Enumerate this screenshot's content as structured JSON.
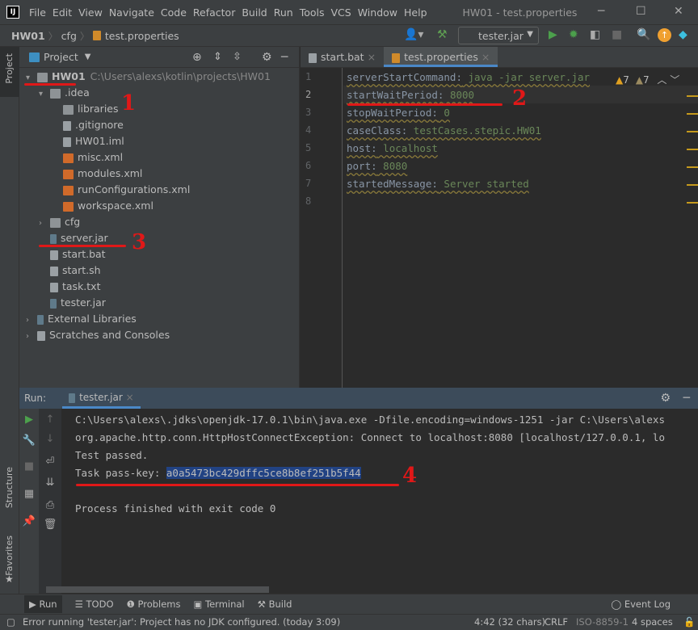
{
  "menubar": {
    "items": [
      "File",
      "Edit",
      "View",
      "Navigate",
      "Code",
      "Refactor",
      "Build",
      "Run",
      "Tools",
      "VCS",
      "Window",
      "Help"
    ],
    "window_title": "HW01 - test.properties"
  },
  "navbar": {
    "crumbs": [
      "HW01",
      "cfg",
      "test.properties"
    ],
    "run_config": "tester.jar"
  },
  "left_strip": {
    "project": "Project",
    "structure": "Structure",
    "favorites": "Favorites"
  },
  "project": {
    "title": "Project",
    "root": {
      "name": "HW01",
      "path": "C:\\Users\\alexs\\kotlin\\projects\\HW01"
    },
    "items": [
      ".idea",
      "libraries",
      ".gitignore",
      "HW01.iml",
      "misc.xml",
      "modules.xml",
      "runConfigurations.xml",
      "workspace.xml",
      "cfg",
      "server.jar",
      "start.bat",
      "start.sh",
      "task.txt",
      "tester.jar",
      "External Libraries",
      "Scratches and Consoles"
    ]
  },
  "editor": {
    "tabs": [
      "start.bat",
      "test.properties"
    ],
    "active_tab": "test.properties",
    "lines": [
      {
        "key": "serverStartCommand:",
        "value": " java -jar server.jar"
      },
      {
        "key": "startWaitPeriod:",
        "value": " 8000"
      },
      {
        "key": "stopWaitPeriod:",
        "value": " 0"
      },
      {
        "key": "caseClass:",
        "value": " testCases.stepic.HW01"
      },
      {
        "key": "host:",
        "value": " localhost"
      },
      {
        "key": "port:",
        "value": " 8080"
      },
      {
        "key": "startedMessage:",
        "value": " Server started"
      }
    ],
    "line_numbers": [
      "1",
      "2",
      "3",
      "4",
      "5",
      "6",
      "7",
      "8"
    ],
    "warnings": "7",
    "weak_warnings": "7"
  },
  "run": {
    "label": "Run:",
    "tab": "tester.jar",
    "output": [
      "C:\\Users\\alexs\\.jdks\\openjdk-17.0.1\\bin\\java.exe -Dfile.encoding=windows-1251 -jar C:\\Users\\alexs",
      "org.apache.http.conn.HttpHostConnectException: Connect to localhost:8080 [localhost/127.0.0.1, lo",
      "Test passed."
    ],
    "passkey_label": "Task pass-key: ",
    "passkey": "a0a5473bc429dffc5ce8b8ef251b5f44",
    "finished": "Process finished with exit code 0"
  },
  "bottom_tools": [
    "Run",
    "TODO",
    "Problems",
    "Terminal",
    "Build"
  ],
  "event_log": "Event Log",
  "status": {
    "message": "Error running 'tester.jar': Project has no JDK configured. (today 3:09)",
    "position": "4:42 (32 chars)",
    "line_sep": "CRLF",
    "encoding": "ISO-8859-1",
    "indent": "4 spaces"
  },
  "annotations": [
    "1",
    "2",
    "3",
    "4"
  ],
  "colors": {
    "annotation": "#e01818",
    "selection": "#214283",
    "accent": "#4a88c7"
  }
}
